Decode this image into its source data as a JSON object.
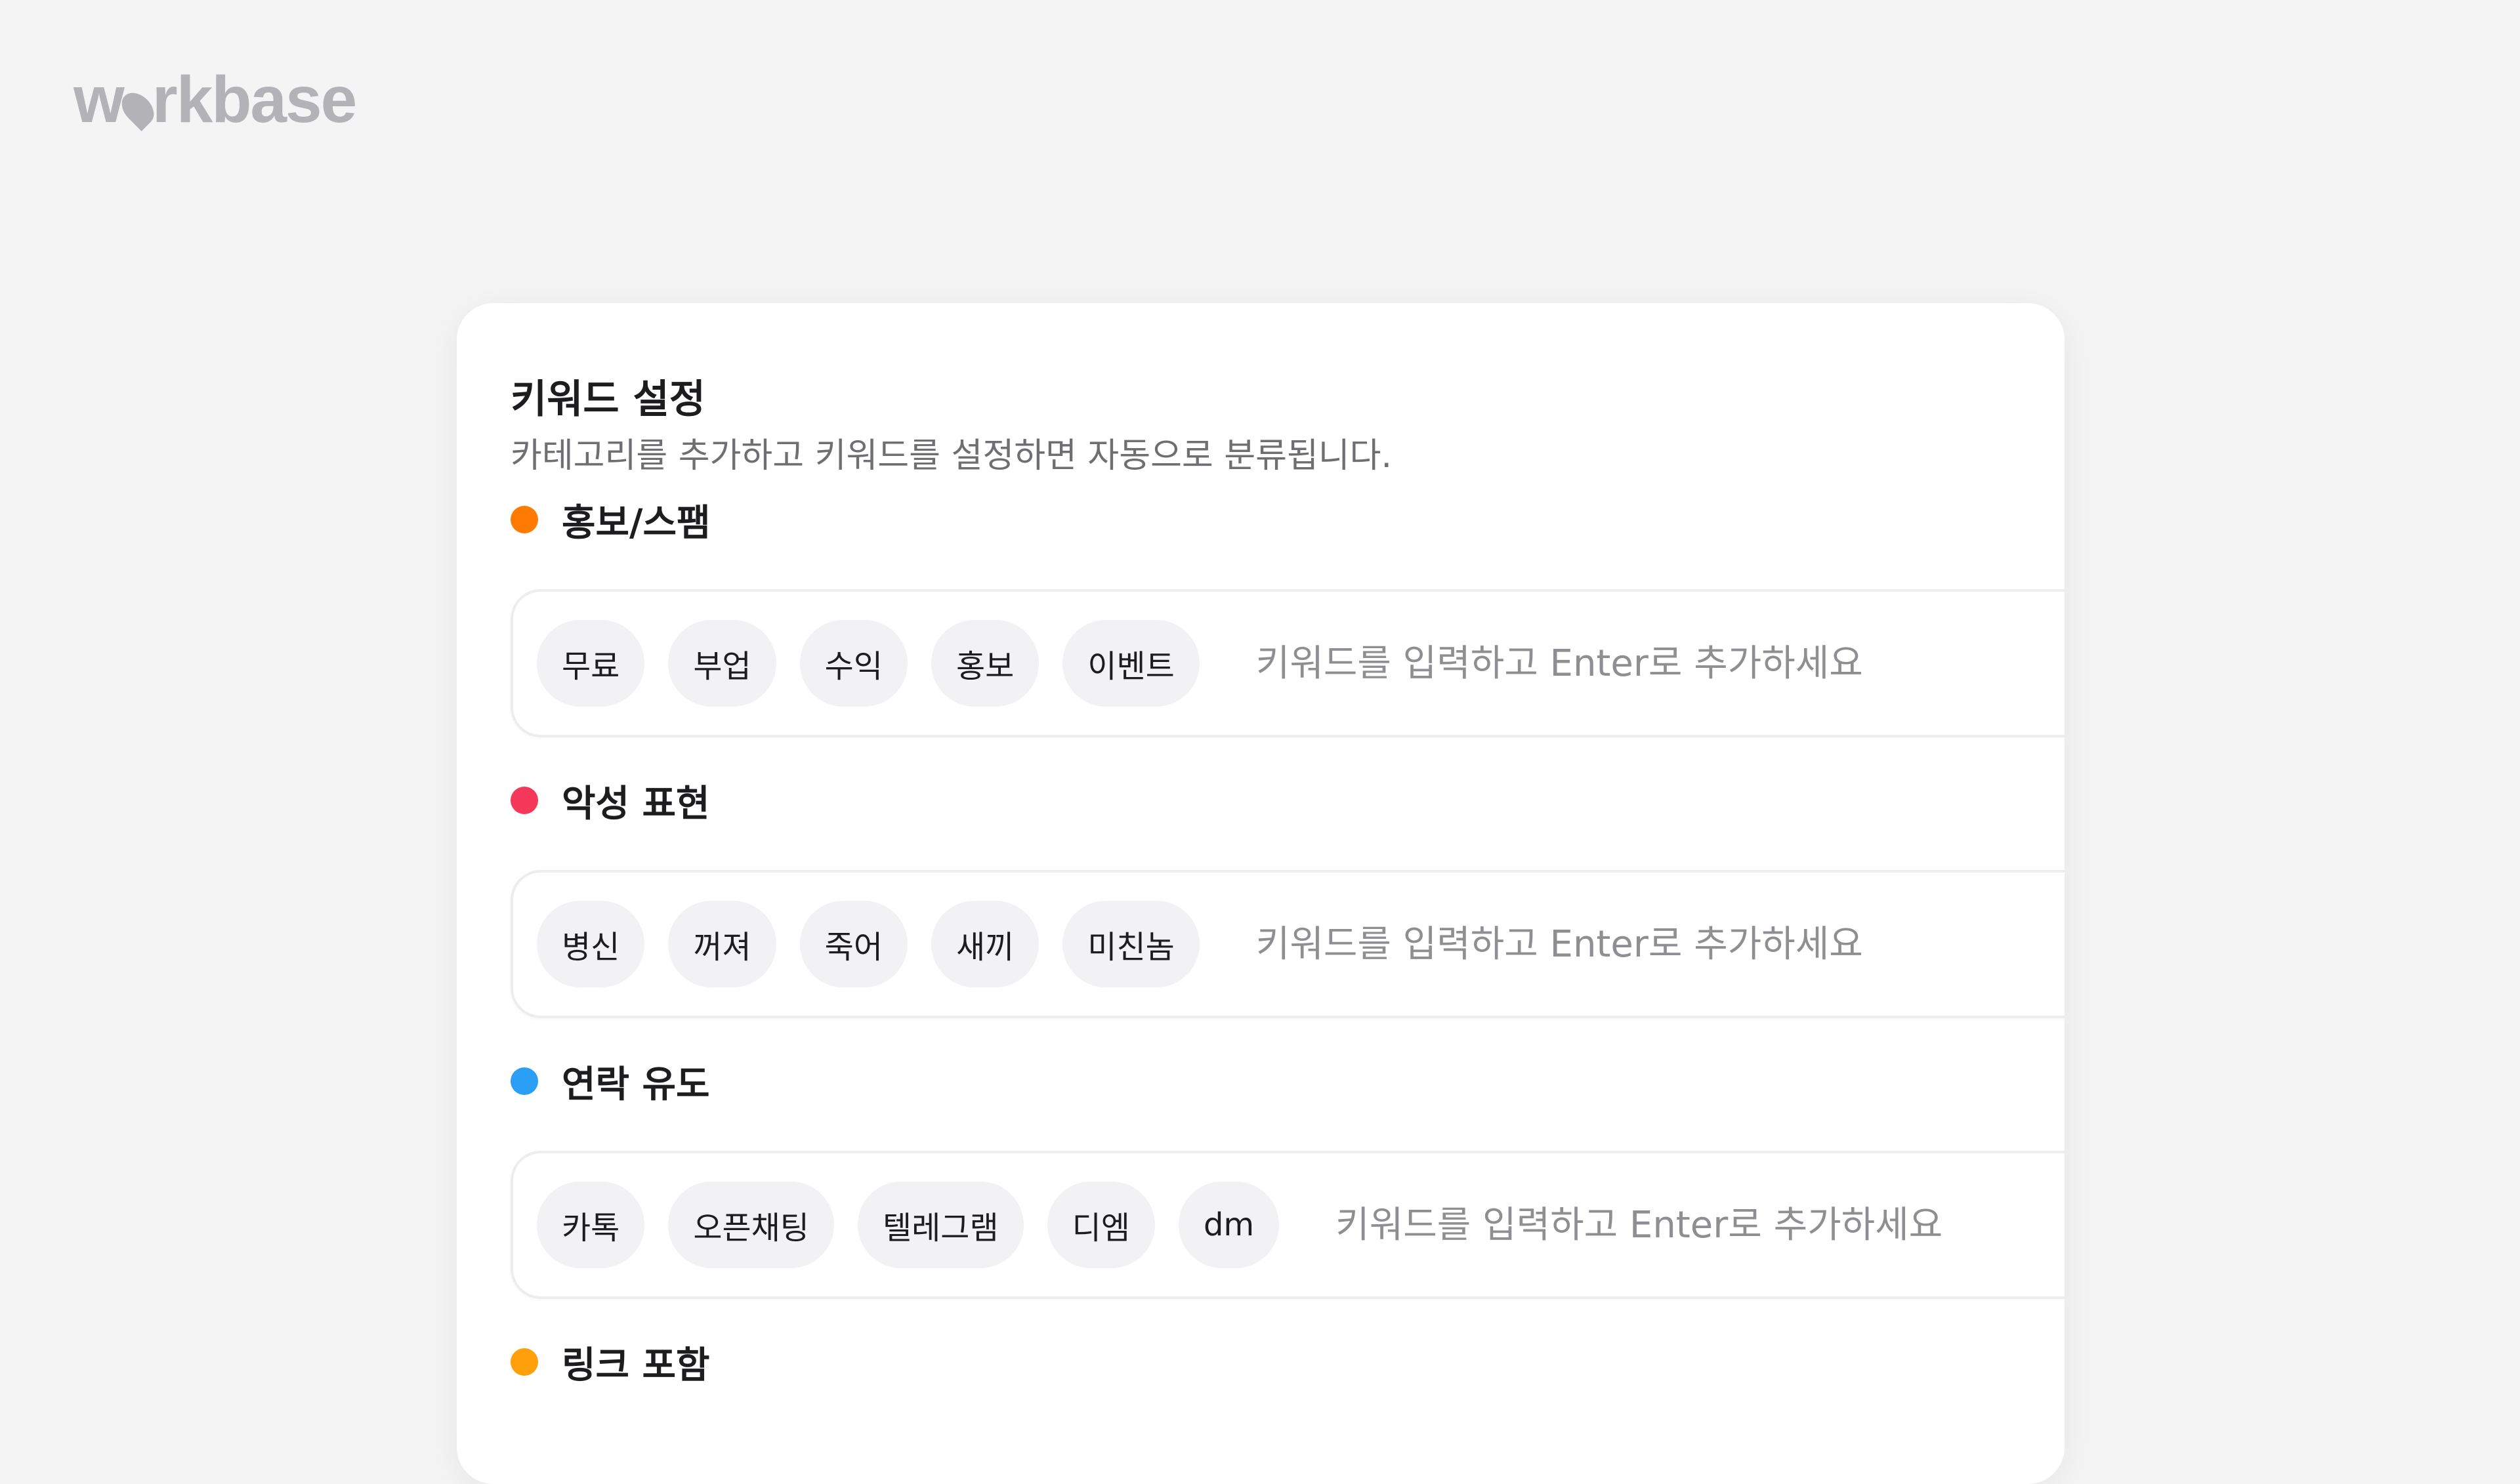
{
  "logo": {
    "text_before": "w",
    "text_after": "rkbase"
  },
  "card": {
    "title": "키워드 설정",
    "subtitle": "카테고리를 추가하고 키워드를 설정하면 자동으로 분류됩니다."
  },
  "categories": [
    {
      "label": "홍보/스팸",
      "color": "#ff7a00",
      "keywords": [
        "무료",
        "부업",
        "수익",
        "홍보",
        "이벤트"
      ],
      "placeholder": "키워드를 입력하고 Enter로 추가하세요"
    },
    {
      "label": "악성 표현",
      "color": "#f5385a",
      "keywords": [
        "병신",
        "꺼져",
        "죽어",
        "새끼",
        "미친놈"
      ],
      "placeholder": "키워드를 입력하고 Enter로 추가하세요"
    },
    {
      "label": "연락 유도",
      "color": "#2b9ef5",
      "keywords": [
        "카톡",
        "오픈채팅",
        "텔레그램",
        "디엠",
        "dm"
      ],
      "placeholder": "키워드를 입력하고 Enter로 추가하세요"
    },
    {
      "label": "링크 포함",
      "color": "#ff9f0a",
      "keywords": [],
      "placeholder": ""
    }
  ]
}
